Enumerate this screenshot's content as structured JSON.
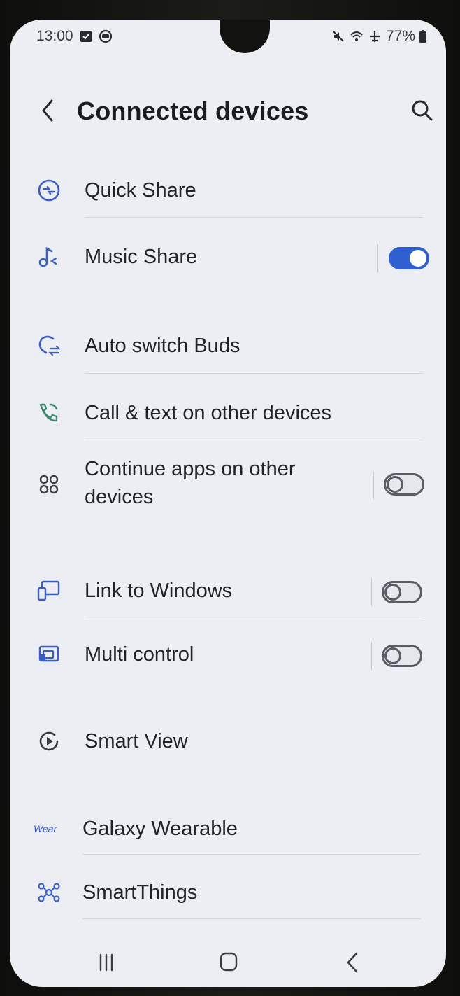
{
  "status_bar": {
    "time": "13:00",
    "battery": "77%",
    "icons_left": [
      "checkbox-notification-icon",
      "sync-notification-icon"
    ],
    "icons_right": [
      "mute-icon",
      "wifi-icon",
      "airplane-icon",
      "battery-icon"
    ]
  },
  "header": {
    "title": "Connected devices",
    "back_icon": "chevron-left-icon",
    "search_icon": "search-icon"
  },
  "items": [
    {
      "label": "Quick Share",
      "icon": "quick-share-icon"
    },
    {
      "label": "Music Share",
      "icon": "music-share-icon",
      "toggle": "on"
    },
    {
      "label": "Auto switch Buds",
      "icon": "auto-switch-buds-icon"
    },
    {
      "label": "Call & text on other devices",
      "icon": "call-text-icon"
    },
    {
      "label_line1": "Continue apps on other",
      "label_line2": "devices",
      "icon": "continue-apps-icon",
      "toggle": "off"
    },
    {
      "label": "Link to Windows",
      "icon": "link-to-windows-icon",
      "toggle": "off"
    },
    {
      "label": "Multi control",
      "icon": "multi-control-icon",
      "toggle": "off"
    },
    {
      "label": "Smart View",
      "icon": "smart-view-icon"
    },
    {
      "label": "Galaxy Wearable",
      "icon_text": "Wear"
    },
    {
      "label": "SmartThings",
      "icon": "smartthings-icon"
    }
  ],
  "navigation_bar": {
    "recents_icon": "recents-icon",
    "home_icon": "home-icon",
    "back_icon": "back-icon"
  },
  "colors": {
    "accent": "#2f5fd1",
    "icon_blue": "#3a5fc4",
    "icon_green": "#3d8a6a",
    "background": "#eceef3",
    "text": "#222329"
  }
}
